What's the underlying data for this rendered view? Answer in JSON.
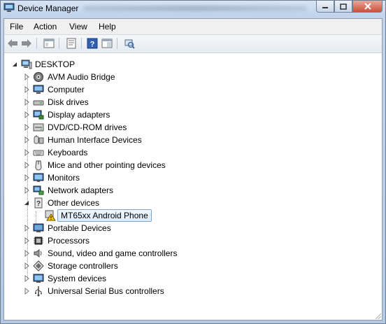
{
  "window": {
    "title": "Device Manager"
  },
  "menu": {
    "file": "File",
    "action": "Action",
    "view": "View",
    "help": "Help"
  },
  "toolbar": {
    "buttons": [
      "back-icon",
      "forward-icon",
      "show-hide-tree-icon",
      "properties-icon",
      "help-icon",
      "properties-pane-icon",
      "scan-hardware-icon"
    ]
  },
  "tree": {
    "root": "DESKTOP",
    "items": [
      {
        "label": "AVM Audio Bridge",
        "icon": "audio-icon"
      },
      {
        "label": "Computer",
        "icon": "computer-icon"
      },
      {
        "label": "Disk drives",
        "icon": "disk-drive-icon"
      },
      {
        "label": "Display adapters",
        "icon": "display-adapter-icon"
      },
      {
        "label": "DVD/CD-ROM drives",
        "icon": "dvd-drive-icon"
      },
      {
        "label": "Human Interface Devices",
        "icon": "hid-icon"
      },
      {
        "label": "Keyboards",
        "icon": "keyboard-icon"
      },
      {
        "label": "Mice and other pointing devices",
        "icon": "mouse-icon"
      },
      {
        "label": "Monitors",
        "icon": "monitor-icon"
      },
      {
        "label": "Network adapters",
        "icon": "network-adapter-icon"
      },
      {
        "label": "Other devices",
        "icon": "unknown-device-icon"
      },
      {
        "label": "MT65xx Android Phone",
        "icon": "warning-device-icon"
      },
      {
        "label": "Portable Devices",
        "icon": "portable-device-icon"
      },
      {
        "label": "Processors",
        "icon": "processor-icon"
      },
      {
        "label": "Sound, video and game controllers",
        "icon": "sound-icon"
      },
      {
        "label": "Storage controllers",
        "icon": "storage-controller-icon"
      },
      {
        "label": "System devices",
        "icon": "system-device-icon"
      },
      {
        "label": "Universal Serial Bus controllers",
        "icon": "usb-icon"
      }
    ]
  }
}
